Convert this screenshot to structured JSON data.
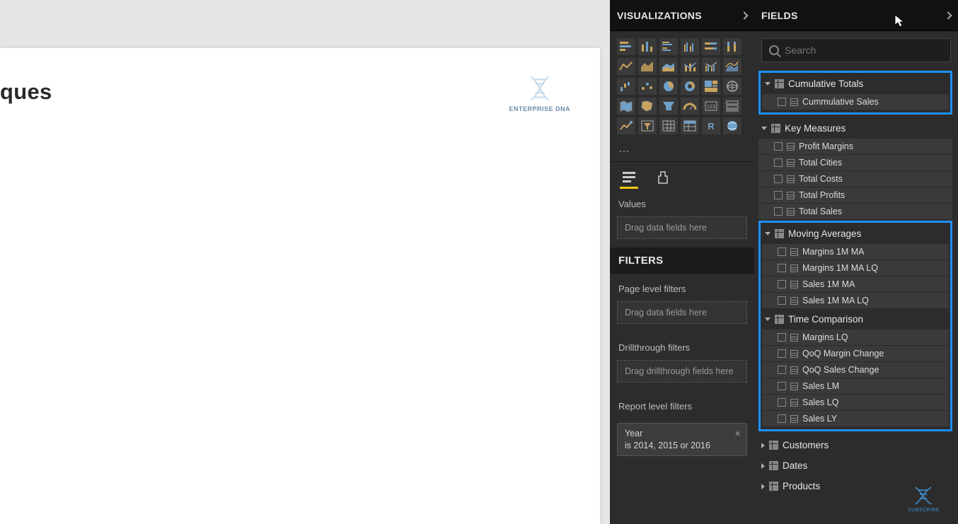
{
  "canvas": {
    "title_fragment": "ques",
    "logo_text": "ENTERPRISE DNA"
  },
  "viz_panel": {
    "header": "VISUALIZATIONS",
    "more": "…",
    "values_label": "Values",
    "values_drop": "Drag data fields here",
    "filters_header": "FILTERS",
    "page_filters_label": "Page level filters",
    "page_filters_drop": "Drag data fields here",
    "drillthrough_label": "Drillthrough filters",
    "drillthrough_drop": "Drag drillthrough fields here",
    "report_filters_label": "Report level filters",
    "report_filter": {
      "field": "Year",
      "condition": "is 2014, 2015 or 2016"
    }
  },
  "fields_panel": {
    "header": "FIELDS",
    "search_placeholder": "Search",
    "tables": [
      {
        "name": "Cumulative Totals",
        "expanded": true,
        "highlighted": true,
        "fields": [
          {
            "name": "Cummulative Sales"
          }
        ]
      },
      {
        "name": "Key Measures",
        "expanded": true,
        "highlighted": false,
        "fields": [
          {
            "name": "Profit Margins"
          },
          {
            "name": "Total Cities"
          },
          {
            "name": "Total Costs"
          },
          {
            "name": "Total Profits"
          },
          {
            "name": "Total Sales"
          }
        ]
      },
      {
        "name": "Moving Averages",
        "expanded": true,
        "highlighted": true,
        "fields": [
          {
            "name": "Margins 1M MA"
          },
          {
            "name": "Margins 1M MA LQ"
          },
          {
            "name": "Sales 1M MA"
          },
          {
            "name": "Sales 1M MA LQ"
          }
        ]
      },
      {
        "name": "Time Comparison",
        "expanded": true,
        "highlighted": true,
        "fields": [
          {
            "name": "Margins LQ"
          },
          {
            "name": "QoQ Margin Change"
          },
          {
            "name": "QoQ Sales Change"
          },
          {
            "name": "Sales LM"
          },
          {
            "name": "Sales LQ"
          },
          {
            "name": "Sales LY"
          }
        ]
      },
      {
        "name": "Customers",
        "expanded": false,
        "highlighted": false,
        "fields": []
      },
      {
        "name": "Dates",
        "expanded": false,
        "highlighted": false,
        "fields": []
      },
      {
        "name": "Products",
        "expanded": false,
        "highlighted": false,
        "fields": []
      }
    ]
  },
  "subscribe_label": "SUBSCRIBE"
}
